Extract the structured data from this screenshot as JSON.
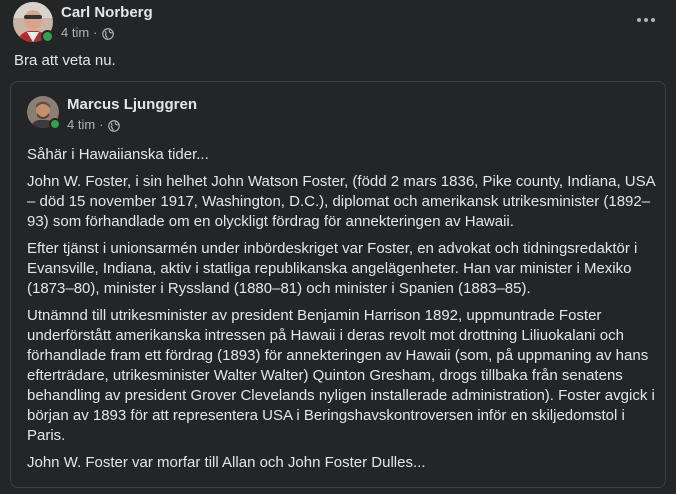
{
  "post": {
    "author": "Carl Norberg",
    "time": "4 tim",
    "separator": "·",
    "privacy_icon": "globe-icon",
    "text": "Bra att veta nu.",
    "more_icon": "more-horizontal-icon"
  },
  "shared_post": {
    "author": "Marcus Ljunggren",
    "time": "4 tim",
    "separator": "·",
    "privacy_icon": "globe-icon",
    "paragraphs": [
      "Såhär i Hawaiianska tider...",
      "John W. Foster, i sin helhet John Watson Foster, (född 2 mars 1836, Pike county, Indiana, USA – död 15 november 1917, Washington, D.C.), diplomat och amerikansk utrikesminister (1892–93) som förhandlade om en olyckligt fördrag för annekteringen av Hawaii.",
      "Efter tjänst i unionsarmén under inbördeskriget var Foster, en advokat och tidningsredaktör i Evansville, Indiana, aktiv i statliga republikanska angelägenheter. Han var minister i Mexiko (1873–80), minister i Ryssland (1880–81) och minister i Spanien (1883–85).",
      "Utnämnd till utrikesminister av president Benjamin Harrison 1892, uppmuntrade Foster underförstått amerikanska intressen på Hawaii i deras revolt mot drottning Liliuokalani och förhandlade fram ett fördrag (1893) för annekteringen av Hawaii (som, på uppmaning av hans efterträdare, utrikesminister Walter Walter) Quinton Gresham, drogs tillbaka från senatens behandling av president Grover Clevelands nyligen installerade administration). Foster avgick i början av 1893 för att representera USA i Beringshavskontroversen inför en skiljedomstol i Paris.",
      "John W. Foster var morfar till Allan och John Foster Dulles..."
    ]
  },
  "colors": {
    "background": "#242526",
    "text_primary": "#e4e6eb",
    "text_secondary": "#b0b3b8",
    "online": "#31a24c",
    "card_border": "#3e4042"
  }
}
